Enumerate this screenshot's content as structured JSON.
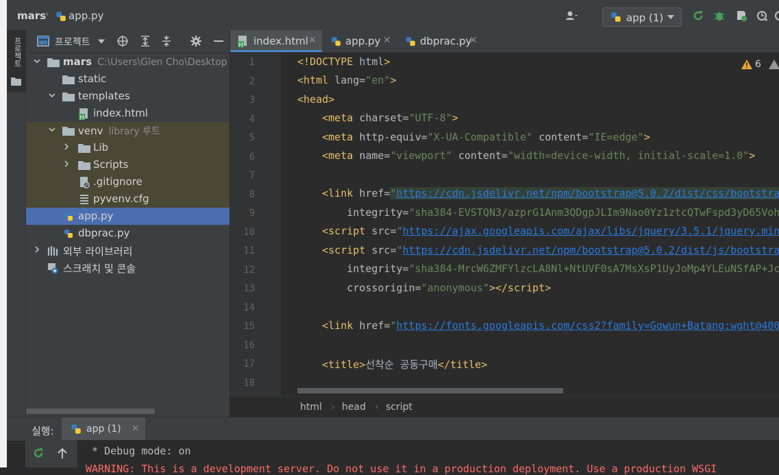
{
  "navbar": {
    "project": "mars",
    "file": "app.py",
    "run_config": "app (1)"
  },
  "sidebar": {
    "tab_label": "프로젝트"
  },
  "project_panel": {
    "title": "프로젝트",
    "items": [
      {
        "label": "mars",
        "hint": "C:\\Users\\Glen Cho\\Desktop",
        "icon": "folder-icon"
      },
      {
        "label": "static",
        "hint": "",
        "icon": "folder-icon"
      },
      {
        "label": "templates",
        "hint": "",
        "icon": "folder-icon"
      },
      {
        "label": "index.html",
        "hint": "",
        "icon": "html-file-icon"
      },
      {
        "label": "venv",
        "hint": "library 루트",
        "icon": "folder-icon"
      },
      {
        "label": "Lib",
        "hint": "",
        "icon": "folder-icon"
      },
      {
        "label": "Scripts",
        "hint": "",
        "icon": "folder-icon"
      },
      {
        "label": ".gitignore",
        "hint": "",
        "icon": "gitignore-file-icon"
      },
      {
        "label": "pyvenv.cfg",
        "hint": "",
        "icon": "config-file-icon"
      },
      {
        "label": "app.py",
        "hint": "",
        "icon": "python-file-icon"
      },
      {
        "label": "dbprac.py",
        "hint": "",
        "icon": "python-file-icon"
      },
      {
        "label": "외부 라이브러리",
        "hint": "",
        "icon": "library-icon"
      },
      {
        "label": "스크래치 및 콘솔",
        "hint": "",
        "icon": "scratch-icon"
      }
    ]
  },
  "tabs": [
    {
      "label": "index.html",
      "active": true
    },
    {
      "label": "app.py",
      "active": false
    },
    {
      "label": "dbprac.py",
      "active": false
    }
  ],
  "editor": {
    "warnings": "6",
    "line_numbers": [
      "1",
      "2",
      "3",
      "4",
      "5",
      "6",
      "7",
      "8",
      "9",
      "10",
      "11",
      "12",
      "13",
      "14",
      "15",
      "16",
      "17",
      "18"
    ]
  },
  "breadcrumb": [
    "html",
    "head",
    "script"
  ],
  "run_panel": {
    "label": "실행:",
    "tab": "app (1)",
    "console": [
      " * Debug mode: on",
      "WARNING: This is a development server. Do not use it in a production deployment. Use a production WSGI"
    ]
  },
  "colors": {
    "bg": "#2b2b2b",
    "panel": "#3c3f41",
    "selection": "#4b6eaf",
    "tag": "#e8bf6a",
    "string": "#6a8759",
    "url": "#287bde",
    "warning_text": "#ff6b68",
    "run_green": "#499c54"
  }
}
